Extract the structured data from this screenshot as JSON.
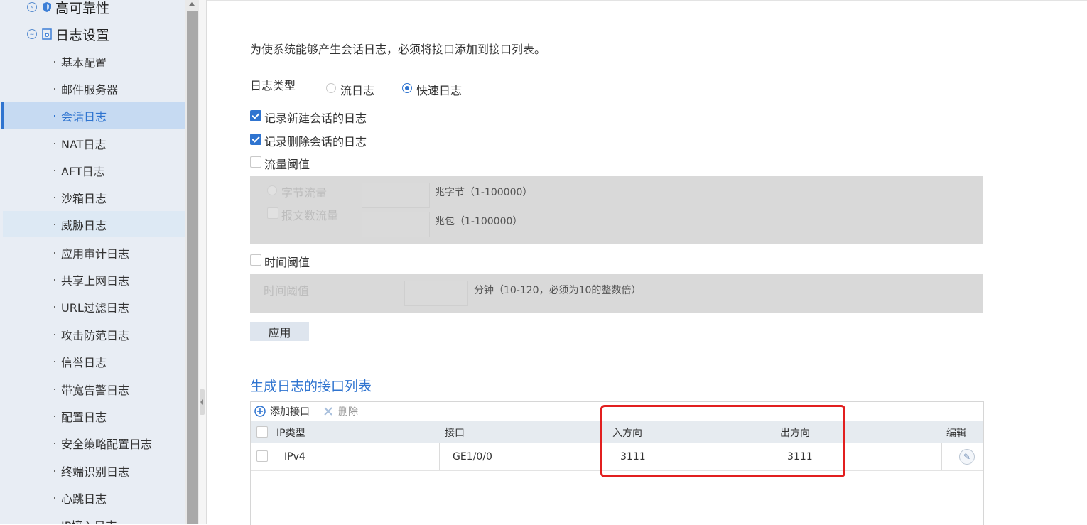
{
  "sidebar": {
    "groups": [
      {
        "label": "高可靠性"
      },
      {
        "label": "日志设置"
      }
    ],
    "items": [
      {
        "label": "基本配置"
      },
      {
        "label": "邮件服务器"
      },
      {
        "label": "会话日志"
      },
      {
        "label": "NAT日志"
      },
      {
        "label": "AFT日志"
      },
      {
        "label": "沙箱日志"
      },
      {
        "label": "威胁日志"
      },
      {
        "label": "应用审计日志"
      },
      {
        "label": "共享上网日志"
      },
      {
        "label": "URL过滤日志"
      },
      {
        "label": "攻击防范日志"
      },
      {
        "label": "信誉日志"
      },
      {
        "label": "带宽告警日志"
      },
      {
        "label": "配置日志"
      },
      {
        "label": "安全策略配置日志"
      },
      {
        "label": "终端识别日志"
      },
      {
        "label": "心跳日志"
      },
      {
        "label": "IP接入日志"
      }
    ]
  },
  "main": {
    "description": "为使系统能够产生会话日志，必须将接口添加到接口列表。",
    "log_type_label": "日志类型",
    "log_type_options": [
      {
        "label": "流日志",
        "checked": false
      },
      {
        "label": "快速日志",
        "checked": true
      }
    ],
    "record_new_session": {
      "label": "记录新建会话的日志",
      "checked": true
    },
    "record_delete_session": {
      "label": "记录删除会话的日志",
      "checked": true
    },
    "traffic_threshold": {
      "label": "流量阈值",
      "checked": false,
      "byte_flow_label": "字节流量",
      "packet_flow_label": "报文数流量",
      "byte_hint": "兆字节（1-100000）",
      "packet_hint": "兆包（1-100000）"
    },
    "time_threshold": {
      "label": "时间阈值",
      "checked": false,
      "inner_label": "时间阈值",
      "hint": "分钟（10-120，必须为10的整数倍）"
    },
    "apply_label": "应用",
    "list_title": "生成日志的接口列表",
    "toolbar": {
      "add_label": "添加接口",
      "delete_label": "删除"
    },
    "table": {
      "headers": [
        "IP类型",
        "接口",
        "入方向",
        "出方向",
        "编辑"
      ],
      "rows": [
        {
          "ip_type": "IPv4",
          "interface": "GE1/0/0",
          "inbound": "3111",
          "outbound": "3111"
        }
      ]
    }
  },
  "colors": {
    "accent": "#2f74d0",
    "highlight": "#e21f1f"
  }
}
